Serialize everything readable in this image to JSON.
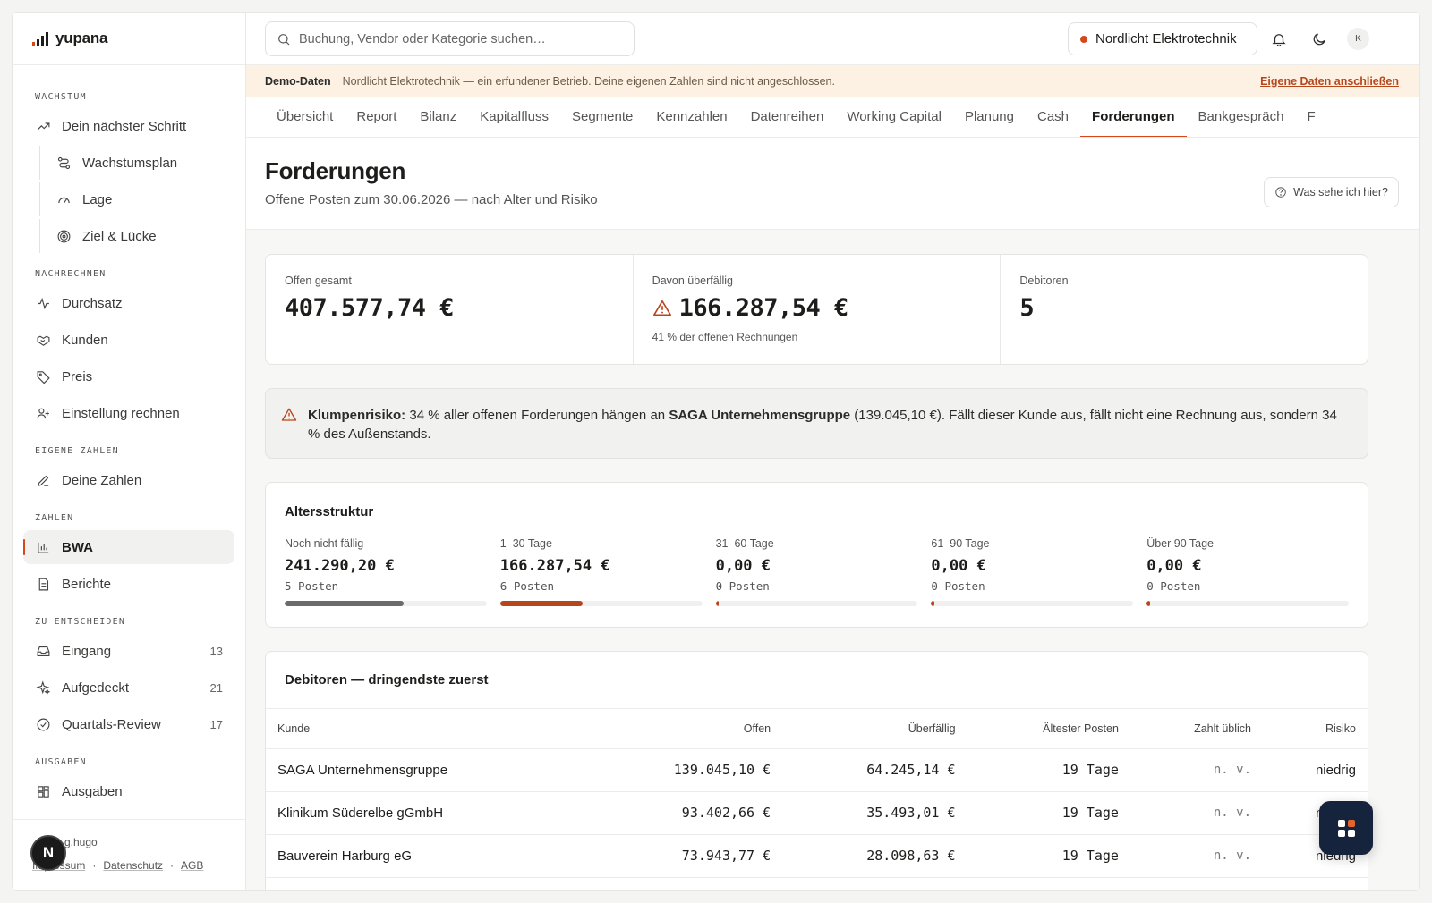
{
  "brand": {
    "name": "yupana"
  },
  "sidebar": {
    "sections": [
      {
        "label": "WACHSTUM"
      },
      {
        "label": "NACHRECHNEN"
      },
      {
        "label": "EIGENE ZAHLEN"
      },
      {
        "label": "ZAHLEN"
      },
      {
        "label": "ZU ENTSCHEIDEN"
      },
      {
        "label": "AUSGABEN"
      }
    ],
    "items": {
      "next_step": "Dein nächster Schritt",
      "growth_plan": "Wachstumsplan",
      "lage": "Lage",
      "ziel": "Ziel & Lücke",
      "durchsatz": "Durchsatz",
      "kunden": "Kunden",
      "preis": "Preis",
      "einstellung": "Einstellung rechnen",
      "deine_zahlen": "Deine Zahlen",
      "bwa": "BWA",
      "berichte": "Berichte",
      "eingang": "Eingang",
      "eingang_count": "13",
      "aufgedeckt": "Aufgedeckt",
      "aufgedeckt_count": "21",
      "review": "Quartals-Review",
      "review_count": "17",
      "ausgaben": "Ausgaben"
    },
    "footer": {
      "user": "g.hugo",
      "links": [
        "Impressum",
        "Datenschutz",
        "AGB"
      ],
      "sep": "·",
      "badge": "N"
    }
  },
  "topbar": {
    "search_placeholder": "Buchung, Vendor oder Kategorie suchen…",
    "company": "Nordlicht Elektrotechnik",
    "avatar": "K"
  },
  "demo_banner": {
    "tag": "Demo-Daten",
    "message": "Nordlicht Elektrotechnik — ein erfundener Betrieb. Deine eigenen Zahlen sind nicht angeschlossen.",
    "link": "Eigene Daten anschließen"
  },
  "tabs": [
    "Übersicht",
    "Report",
    "Bilanz",
    "Kapitalfluss",
    "Segmente",
    "Kennzahlen",
    "Datenreihen",
    "Working Capital",
    "Planung",
    "Cash",
    "Forderungen",
    "Bankgespräch",
    "F"
  ],
  "page": {
    "title": "Forderungen",
    "subtitle": "Offene Posten zum 30.06.2026 — nach Alter und Risiko",
    "help": "Was sehe ich hier?"
  },
  "kpis": {
    "open_label": "Offen gesamt",
    "open_value": "407.577,74 €",
    "overdue_label": "Davon überfällig",
    "overdue_value": "166.287,54 €",
    "overdue_note": "41 % der offenen Rechnungen",
    "debtors_label": "Debitoren",
    "debtors_value": "5"
  },
  "alert": {
    "label": "Klumpenrisiko:",
    "text1": " 34 % aller offenen Forderungen hängen an ",
    "customer": "SAGA Unternehmensgruppe",
    "text2": " (139.045,10 €). Fällt dieser Kunde aus, fällt nicht eine Rechnung aus, sondern 34 % des Außenstands."
  },
  "aging": {
    "title": "Altersstruktur",
    "buckets": [
      {
        "label": "Noch nicht fällig",
        "value": "241.290,20 €",
        "count": "5 Posten",
        "share": 0.59,
        "color": "#6b6b69"
      },
      {
        "label": "1–30 Tage",
        "value": "166.287,54 €",
        "count": "6 Posten",
        "share": 0.41,
        "color": "#b8461d"
      },
      {
        "label": "31–60 Tage",
        "value": "0,00 €",
        "count": "0 Posten",
        "share": 0.0,
        "color": "#b8461d"
      },
      {
        "label": "61–90 Tage",
        "value": "0,00 €",
        "count": "0 Posten",
        "share": 0.0,
        "color": "#b8461d"
      },
      {
        "label": "Über 90 Tage",
        "value": "0,00 €",
        "count": "0 Posten",
        "share": 0.0,
        "color": "#b8461d"
      }
    ]
  },
  "debtors": {
    "title": "Debitoren — dringendste zuerst",
    "columns": [
      "Kunde",
      "Offen",
      "Überfällig",
      "Ältester Posten",
      "Zahlt üblich",
      "Risiko"
    ],
    "rows": [
      [
        "SAGA Unternehmensgruppe",
        "139.045,10 €",
        "64.245,14 €",
        "19 Tage",
        "n. v.",
        "niedrig"
      ],
      [
        "Klinikum Süderelbe gGmbH",
        "93.402,66 €",
        "35.493,01 €",
        "19 Tage",
        "n. v.",
        "niedrig"
      ],
      [
        "Bauverein Harburg eG",
        "73.943,77 €",
        "28.098,63 €",
        "19 Tage",
        "n. v.",
        "niedrig"
      ]
    ]
  },
  "colors": {
    "accent": "#d6471b",
    "fab": "#15233d"
  }
}
